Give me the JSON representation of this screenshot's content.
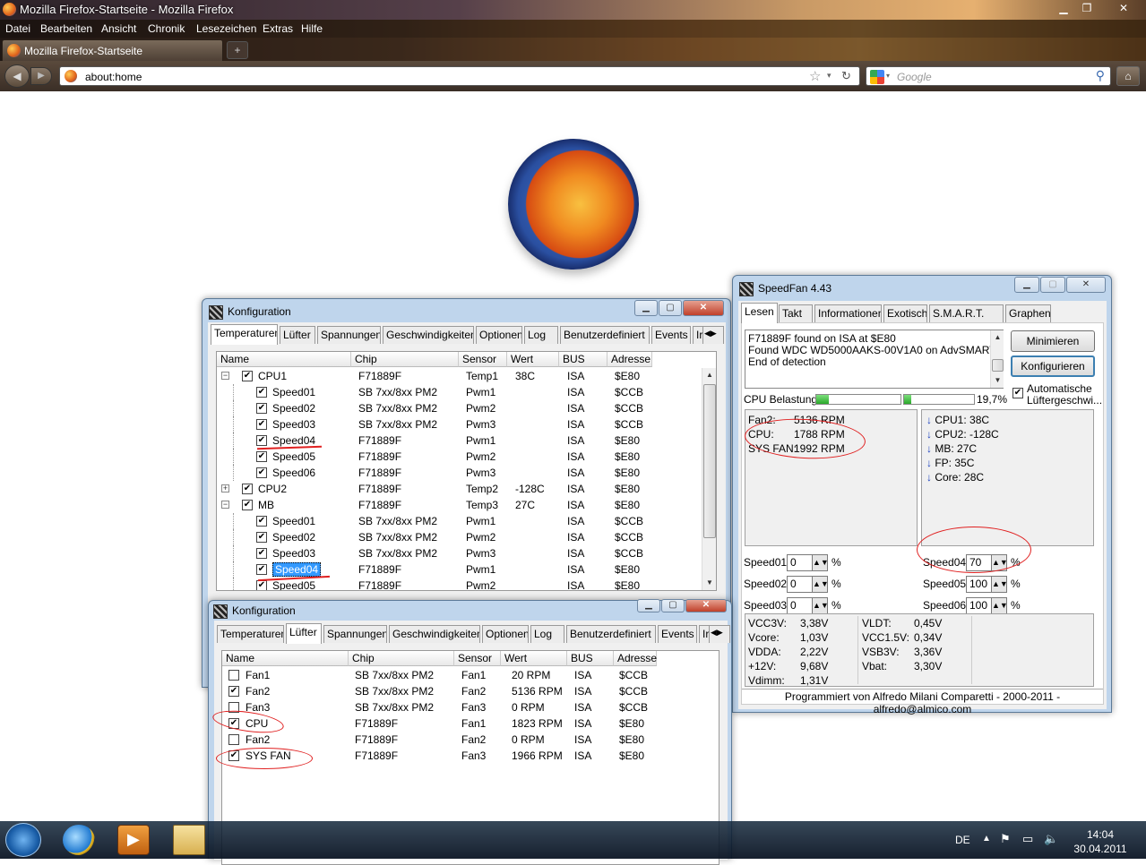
{
  "firefox": {
    "window_title": "Mozilla Firefox-Startseite - Mozilla Firefox",
    "menu": [
      "Datei",
      "Bearbeiten",
      "Ansicht",
      "Chronik",
      "Lesezeichen",
      "Extras",
      "Hilfe"
    ],
    "tab_title": "Mozilla Firefox-Startseite",
    "newtab_glyph": "+",
    "url": "about:home",
    "search_placeholder": "Google"
  },
  "speedfan": {
    "title": "SpeedFan 4.43",
    "tabs": [
      "Lesen",
      "Takt",
      "Informationen",
      "Exotisch",
      "S.M.A.R.T.",
      "Graphen"
    ],
    "log": [
      "F71889F found on ISA at $E80",
      "Found WDC WD5000AAKS-00V1A0 on AdvSMART",
      "End of detection"
    ],
    "btn_minimize": "Minimieren",
    "btn_config": "Konfigurieren",
    "auto_fan_line1": "Automatische",
    "auto_fan_line2": "Lüftergeschwi...",
    "cpu_load_label": "CPU Belastung",
    "cpu_load_value": "19,7%",
    "cpu_load_bar1": 0.15,
    "cpu_load_bar2": 0.1,
    "fans": [
      {
        "label": "Fan2:",
        "value": "5136 RPM"
      },
      {
        "label": "CPU:",
        "value": "1788 RPM"
      },
      {
        "label": "SYS FAN:",
        "value": "1992 RPM"
      }
    ],
    "temps": [
      {
        "label": "CPU1:",
        "value": "38C"
      },
      {
        "label": "CPU2:",
        "value": "-128C"
      },
      {
        "label": "MB:",
        "value": "27C"
      },
      {
        "label": "FP:",
        "value": "35C"
      },
      {
        "label": "Core:",
        "value": "28C"
      }
    ],
    "speeds": [
      {
        "label": "Speed01:",
        "value": "0"
      },
      {
        "label": "Speed02:",
        "value": "0"
      },
      {
        "label": "Speed03:",
        "value": "0"
      },
      {
        "label": "Speed04:",
        "value": "70"
      },
      {
        "label": "Speed05:",
        "value": "100"
      },
      {
        "label": "Speed06:",
        "value": "100"
      }
    ],
    "percent": "%",
    "voltages_left": [
      {
        "label": "VCC3V:",
        "value": "3,38V"
      },
      {
        "label": "Vcore:",
        "value": "1,03V"
      },
      {
        "label": "VDDA:",
        "value": "2,22V"
      },
      {
        "label": "+12V:",
        "value": "9,68V"
      },
      {
        "label": "Vdimm:",
        "value": "1,31V"
      }
    ],
    "voltages_right": [
      {
        "label": "VLDT:",
        "value": "0,45V"
      },
      {
        "label": "VCC1.5V:",
        "value": "0,34V"
      },
      {
        "label": "VSB3V:",
        "value": "3,36V"
      },
      {
        "label": "Vbat:",
        "value": "3,30V"
      }
    ],
    "footer": "Programmiert von Alfredo Milani Comparetti - 2000-2011 - alfredo@almico.com"
  },
  "config1": {
    "title": "Konfiguration",
    "tabs": [
      "Temperaturen",
      "Lüfter",
      "Spannungen",
      "Geschwindigkeiten",
      "Optionen",
      "Log",
      "Benutzerdefiniert",
      "Events",
      "Ir"
    ],
    "headers": [
      "Name",
      "Chip",
      "Sensor",
      "Wert",
      "BUS",
      "Adresse"
    ],
    "rows": [
      {
        "name": "CPU1",
        "chip": "F71889F",
        "sensor": "Temp1",
        "wert": "38C",
        "bus": "ISA",
        "addr": "$E80",
        "level": 0,
        "tog": "−"
      },
      {
        "name": "Speed01",
        "chip": "SB 7xx/8xx PM2",
        "sensor": "Pwm1",
        "wert": "",
        "bus": "ISA",
        "addr": "$CCB",
        "level": 1
      },
      {
        "name": "Speed02",
        "chip": "SB 7xx/8xx PM2",
        "sensor": "Pwm2",
        "wert": "",
        "bus": "ISA",
        "addr": "$CCB",
        "level": 1
      },
      {
        "name": "Speed03",
        "chip": "SB 7xx/8xx PM2",
        "sensor": "Pwm3",
        "wert": "",
        "bus": "ISA",
        "addr": "$CCB",
        "level": 1
      },
      {
        "name": "Speed04",
        "chip": "F71889F",
        "sensor": "Pwm1",
        "wert": "",
        "bus": "ISA",
        "addr": "$E80",
        "level": 1
      },
      {
        "name": "Speed05",
        "chip": "F71889F",
        "sensor": "Pwm2",
        "wert": "",
        "bus": "ISA",
        "addr": "$E80",
        "level": 1
      },
      {
        "name": "Speed06",
        "chip": "F71889F",
        "sensor": "Pwm3",
        "wert": "",
        "bus": "ISA",
        "addr": "$E80",
        "level": 1
      },
      {
        "name": "CPU2",
        "chip": "F71889F",
        "sensor": "Temp2",
        "wert": "-128C",
        "bus": "ISA",
        "addr": "$E80",
        "level": 0,
        "tog": "+"
      },
      {
        "name": "MB",
        "chip": "F71889F",
        "sensor": "Temp3",
        "wert": "27C",
        "bus": "ISA",
        "addr": "$E80",
        "level": 0,
        "tog": "−"
      },
      {
        "name": "Speed01",
        "chip": "SB 7xx/8xx PM2",
        "sensor": "Pwm1",
        "wert": "",
        "bus": "ISA",
        "addr": "$CCB",
        "level": 1
      },
      {
        "name": "Speed02",
        "chip": "SB 7xx/8xx PM2",
        "sensor": "Pwm2",
        "wert": "",
        "bus": "ISA",
        "addr": "$CCB",
        "level": 1
      },
      {
        "name": "Speed03",
        "chip": "SB 7xx/8xx PM2",
        "sensor": "Pwm3",
        "wert": "",
        "bus": "ISA",
        "addr": "$CCB",
        "level": 1
      },
      {
        "name": "Speed04",
        "chip": "F71889F",
        "sensor": "Pwm1",
        "wert": "",
        "bus": "ISA",
        "addr": "$E80",
        "level": 1,
        "selected": true
      },
      {
        "name": "Speed05",
        "chip": "F71889F",
        "sensor": "Pwm2",
        "wert": "",
        "bus": "ISA",
        "addr": "$E80",
        "level": 1
      }
    ]
  },
  "config2": {
    "title": "Konfiguration",
    "tabs": [
      "Temperaturen",
      "Lüfter",
      "Spannungen",
      "Geschwindigkeiten",
      "Optionen",
      "Log",
      "Benutzerdefiniert",
      "Events",
      "Ir"
    ],
    "headers": [
      "Name",
      "Chip",
      "Sensor",
      "Wert",
      "BUS",
      "Adresse"
    ],
    "rows": [
      {
        "name": "Fan1",
        "chip": "SB 7xx/8xx PM2",
        "sensor": "Fan1",
        "wert": "20 RPM",
        "bus": "ISA",
        "addr": "$CCB",
        "checked": false
      },
      {
        "name": "Fan2",
        "chip": "SB 7xx/8xx PM2",
        "sensor": "Fan2",
        "wert": "5136 RPM",
        "bus": "ISA",
        "addr": "$CCB",
        "checked": true
      },
      {
        "name": "Fan3",
        "chip": "SB 7xx/8xx PM2",
        "sensor": "Fan3",
        "wert": "0 RPM",
        "bus": "ISA",
        "addr": "$CCB",
        "checked": false
      },
      {
        "name": "CPU",
        "chip": "F71889F",
        "sensor": "Fan1",
        "wert": "1823 RPM",
        "bus": "ISA",
        "addr": "$E80",
        "checked": true
      },
      {
        "name": "Fan2",
        "chip": "F71889F",
        "sensor": "Fan2",
        "wert": "0 RPM",
        "bus": "ISA",
        "addr": "$E80",
        "checked": false
      },
      {
        "name": "SYS FAN",
        "chip": "F71889F",
        "sensor": "Fan3",
        "wert": "1966 RPM",
        "bus": "ISA",
        "addr": "$E80",
        "checked": true
      }
    ]
  },
  "taskbar": {
    "lang": "DE",
    "time": "14:04",
    "date": "30.04.2011"
  }
}
